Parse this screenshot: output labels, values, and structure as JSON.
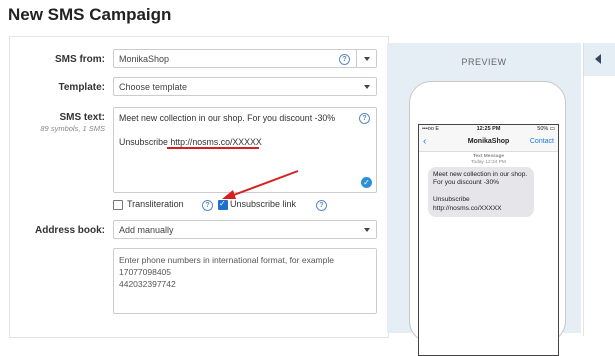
{
  "page": {
    "title": "New SMS Campaign"
  },
  "form": {
    "sms_from": {
      "label": "SMS from:",
      "value": "MonikaShop"
    },
    "template": {
      "label": "Template:",
      "placeholder": "Choose template"
    },
    "sms_text": {
      "label": "SMS text:",
      "meta": "89 symbols, 1 SMS",
      "line1": "Meet new collection in our shop. For you discount -30%",
      "line2": "Unsubscribe http://nosms.co/XXXXX"
    },
    "transliteration": {
      "label": "Transliteration",
      "checked": false
    },
    "unsubscribe_link": {
      "label": "Unsubscribe link",
      "checked": true
    },
    "address_book": {
      "label": "Address book:",
      "value": "Add manually"
    },
    "phones": {
      "placeholder": "Enter phone numbers in international format, for example",
      "examples": [
        "17077098405",
        "442032397742"
      ]
    },
    "help_symbol": "?"
  },
  "preview": {
    "title": "PREVIEW",
    "status_left": "•••oo  E",
    "status_time": "12:25 PM",
    "status_right": "50% ▭",
    "contact_name": "MonikaShop",
    "contact_link": "Contact",
    "stamp_line1": "Text Message",
    "stamp_line2": "Today 12:24 PM",
    "bubble_text": "Meet new collection in our shop.  For you discount -30%\n\nUnsubscribe http://nosms.co/XXXXX"
  },
  "colors": {
    "accent": "#1f6fd1",
    "annotation": "#d62020",
    "preview_bg": "#e6eef5"
  }
}
